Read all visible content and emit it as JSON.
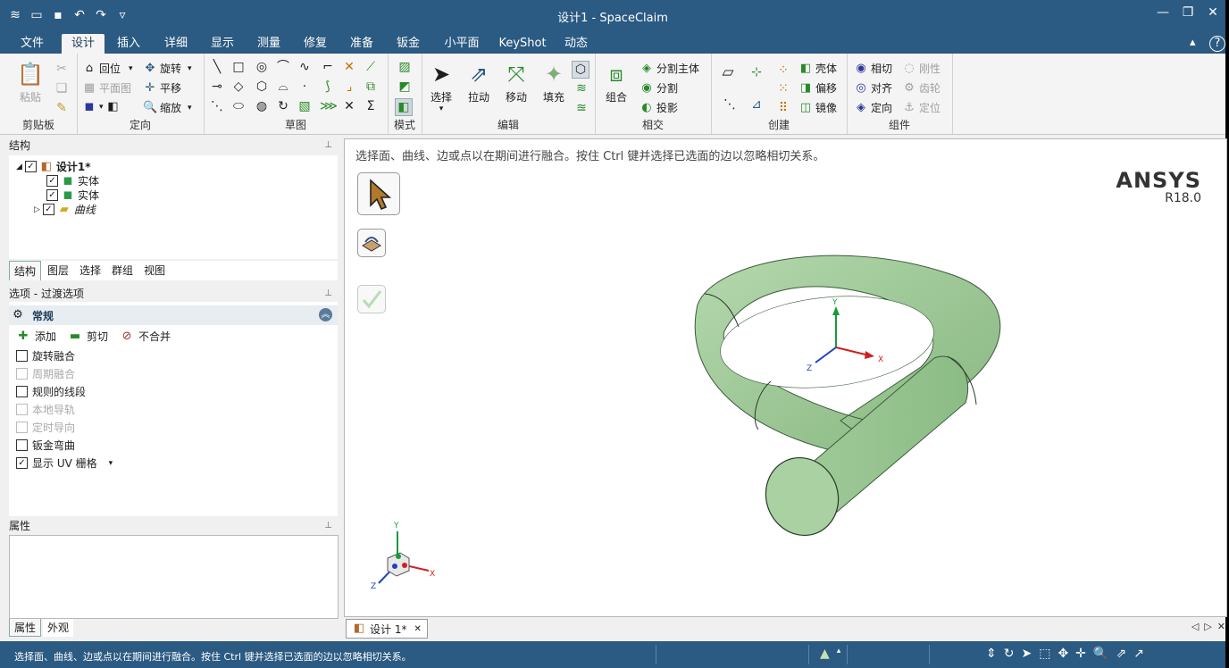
{
  "window": {
    "title": "设计1 - SpaceClaim"
  },
  "tabs": [
    "文件",
    "设计",
    "插入",
    "详细",
    "显示",
    "测量",
    "修复",
    "准备",
    "钣金",
    "小平面",
    "KeyShot",
    "动态"
  ],
  "ribbon": {
    "clipboard": {
      "label": "剪贴板",
      "paste": "粘贴"
    },
    "orient": {
      "label": "定向",
      "home": "回位",
      "rotate": "旋转",
      "plan_view": "平面图",
      "pan": "平移",
      "zoom": "缩放"
    },
    "sketch": {
      "label": "草图"
    },
    "mode": {
      "label": "模式"
    },
    "edit": {
      "label": "编辑",
      "select": "选择",
      "pull": "拉动",
      "move": "移动",
      "fill": "填充"
    },
    "intersect": {
      "label": "相交",
      "combine": "组合",
      "split_body": "分割主体",
      "split": "分割",
      "project": "投影"
    },
    "create": {
      "label": "创建",
      "shell": "壳体",
      "offset": "偏移",
      "mirror": "镜像"
    },
    "assembly": {
      "label": "组件",
      "tangent": "相切",
      "align": "对齐",
      "orient": "定向",
      "rigid": "刚性",
      "gear": "齿轮",
      "anchor": "定位"
    }
  },
  "structure": {
    "header": "结构",
    "root": "设计1*",
    "children": [
      "实体",
      "实体",
      "曲线"
    ],
    "tabs": [
      "结构",
      "图层",
      "选择",
      "群组",
      "视图"
    ]
  },
  "options": {
    "header": "选项 - 过渡选项",
    "section": "常规",
    "actions": [
      "添加",
      "剪切",
      "不合并"
    ],
    "items": [
      {
        "label": "旋转融合",
        "checked": false,
        "enabled": true
      },
      {
        "label": "周期融合",
        "checked": false,
        "enabled": false
      },
      {
        "label": "规则的线段",
        "checked": false,
        "enabled": true
      },
      {
        "label": "本地导轨",
        "checked": false,
        "enabled": false
      },
      {
        "label": "定时导向",
        "checked": false,
        "enabled": false
      },
      {
        "label": "钣金弯曲",
        "checked": false,
        "enabled": true
      },
      {
        "label": "显示 UV 栅格",
        "checked": true,
        "enabled": true
      }
    ]
  },
  "properties": {
    "header": "属性",
    "tabs": [
      "属性",
      "外观"
    ]
  },
  "viewport": {
    "hint": "选择面、曲线、边或点以在期间进行融合。按住 Ctrl 键并选择已选面的边以忽略相切关系。",
    "brand": "ANSYS",
    "version": "R18.0",
    "axes": {
      "x": "X",
      "y": "Y",
      "z": "Z"
    }
  },
  "doc_tab": "设计 1*",
  "status": {
    "message": "选择面、曲线、边或点以在期间进行融合。按住 Ctrl 键并选择已选面的边以忽略相切关系。"
  },
  "colors": {
    "titlebar": "#2b5a82",
    "part": "#a9d1a2",
    "part_shade": "#7fae7a"
  }
}
